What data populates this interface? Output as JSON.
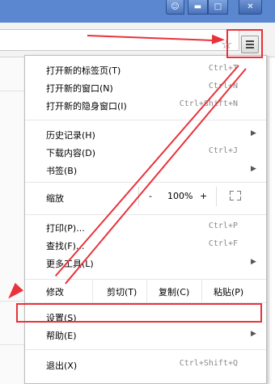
{
  "window": {
    "user_icon": "user-icon",
    "min_icon": "minimize-icon",
    "max_icon": "maximize-icon",
    "close_icon": "close-icon"
  },
  "toolbar": {
    "bookmark_icon": "star-icon",
    "menu_icon": "hamburger-menu-icon"
  },
  "menu": {
    "items": [
      {
        "label": "打开新的标签页(T)",
        "shortcut": "Ctrl+T"
      },
      {
        "label": "打开新的窗口(N)",
        "shortcut": "Ctrl+N"
      },
      {
        "label": "打开新的隐身窗口(I)",
        "shortcut": "Ctrl+Shift+N"
      },
      {
        "label": "历史记录(H)",
        "shortcut": ""
      },
      {
        "label": "下载内容(D)",
        "shortcut": "Ctrl+J"
      },
      {
        "label": "书签(B)",
        "shortcut": ""
      },
      {
        "label": "打印(P)...",
        "shortcut": "Ctrl+P"
      },
      {
        "label": "查找(F)...",
        "shortcut": "Ctrl+F"
      },
      {
        "label": "更多工具(L)",
        "shortcut": ""
      },
      {
        "label": "设置(S)",
        "shortcut": ""
      },
      {
        "label": "帮助(E)",
        "shortcut": ""
      },
      {
        "label": "退出(X)",
        "shortcut": "Ctrl+Shift+Q"
      }
    ],
    "zoom": {
      "label": "缩放",
      "minus": "-",
      "value": "100%",
      "plus": "+"
    },
    "edit": {
      "label": "修改",
      "cut": "剪切(T)",
      "copy": "复制(C)",
      "paste": "粘贴(P)"
    }
  },
  "annotation_color": "#e8333a"
}
